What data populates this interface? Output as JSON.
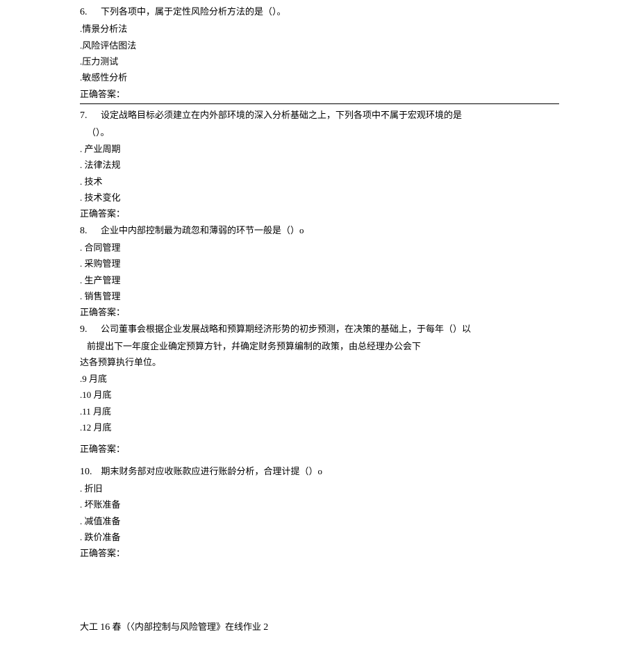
{
  "q6": {
    "number": "6.",
    "text": "下列各项中，属于定性风险分析方法的是（）。",
    "options": [
      ".情景分析法",
      ".风险评估图法",
      ".压力测试",
      ".敏感性分析"
    ],
    "answer_label": "正确答案："
  },
  "q7": {
    "number": "7.",
    "text": "设定战略目标必须建立在内外部环境的深入分析基础之上，下列各项中不属于宏观环境的是",
    "text_cont": "（）。",
    "options": [
      ". 产业周期",
      ". 法律法规",
      ". 技术",
      ". 技术变化"
    ],
    "answer_label": "正确答案："
  },
  "q8": {
    "number": "8.",
    "text": "企业中内部控制最为疏忽和薄弱的环节一般是（）o",
    "options": [
      ". 合同管理",
      ". 采购管理",
      ". 生产管理",
      ". 销售管理"
    ],
    "answer_label": "正确答案："
  },
  "q9": {
    "number": "9.",
    "text": "公司董事会根据企业发展战略和预算期经济形势的初步预测，在决策的基础上，于每年（）以",
    "text_cont": "前提出下一年度企业确定预算方针，幷确定财务预算编制的政策，由总经理办公会下",
    "text_cont2": "达各预算执行单位。",
    "options": [
      ".9 月底",
      ".10 月底",
      ".11 月底",
      ".12 月底"
    ],
    "answer_label": "正确答案："
  },
  "q10": {
    "number": "10.",
    "text": "期末财务部对应收账款应进行账龄分析，合理计提（）o",
    "options": [
      ". 折旧",
      ". 坏账准备",
      ". 减值准备",
      ". 跌价准备"
    ],
    "answer_label": "正确答案："
  },
  "footer": {
    "text_part1": "大工 ",
    "text_num1": "16",
    "text_part2": " 春（〈内部控制与风险管理》在线作业 ",
    "text_num2": "2"
  }
}
